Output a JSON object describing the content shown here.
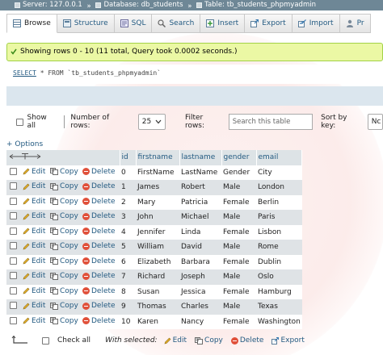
{
  "breadcrumb": {
    "server": "Server: 127.0.0.1",
    "database": "Database: db_students",
    "table": "Table: tb_students_phpmyadmin"
  },
  "tabs": [
    {
      "label": "Browse",
      "icon": "browse-icon",
      "active": true
    },
    {
      "label": "Structure",
      "icon": "structure-icon"
    },
    {
      "label": "SQL",
      "icon": "sql-icon"
    },
    {
      "label": "Search",
      "icon": "search-icon"
    },
    {
      "label": "Insert",
      "icon": "insert-icon"
    },
    {
      "label": "Export",
      "icon": "export-icon"
    },
    {
      "label": "Import",
      "icon": "import-icon"
    },
    {
      "label": "Pr",
      "icon": "privileges-icon"
    }
  ],
  "message": "Showing rows 0 - 10 (11 total, Query took 0.0002 seconds.)",
  "sql": {
    "keyword_select": "SELECT",
    "rest": " * FROM ",
    "table": "`tb_students_phpmyadmin`"
  },
  "filters": {
    "show_all": "Show all",
    "number_of_rows_label": "Number of rows:",
    "number_of_rows_value": "25",
    "filter_rows_label": "Filter rows:",
    "filter_placeholder": "Search this table",
    "sort_by_key_label": "Sort by key:",
    "sort_by_key_value": "Nc"
  },
  "options_link": "+ Options",
  "columns": [
    "id",
    "firstname",
    "lastname",
    "gender",
    "email"
  ],
  "row_actions": {
    "edit": "Edit",
    "copy": "Copy",
    "delete": "Delete"
  },
  "rows": [
    [
      "0",
      "FirstName",
      "LastName",
      "Gender",
      "City"
    ],
    [
      "1",
      "James",
      "Robert",
      "Male",
      "London"
    ],
    [
      "2",
      "Mary",
      "Patricia",
      "Female",
      "Berlin"
    ],
    [
      "3",
      "John",
      "Michael",
      "Male",
      "Paris"
    ],
    [
      "4",
      "Jennifer",
      "Linda",
      "Female",
      "Lisbon"
    ],
    [
      "5",
      "William",
      "David",
      "Male",
      "Rome"
    ],
    [
      "6",
      "Elizabeth",
      "Barbara",
      "Female",
      "Dublin"
    ],
    [
      "7",
      "Richard",
      "Joseph",
      "Male",
      "Oslo"
    ],
    [
      "8",
      "Susan",
      "Jessica",
      "Female",
      "Hamburg"
    ],
    [
      "9",
      "Thomas",
      "Charles",
      "Male",
      "Texas"
    ],
    [
      "10",
      "Karen",
      "Nancy",
      "Female",
      "Washington"
    ]
  ],
  "footer": {
    "check_all": "Check all",
    "with_selected": "With selected:",
    "edit": "Edit",
    "copy": "Copy",
    "delete": "Delete",
    "export": "Export"
  },
  "colors": {
    "topbar": "#6e8796",
    "link": "#235a81",
    "success_bg": "#ebf8a4",
    "success_border": "#a2d246",
    "delete_icon": "#e0503a"
  }
}
